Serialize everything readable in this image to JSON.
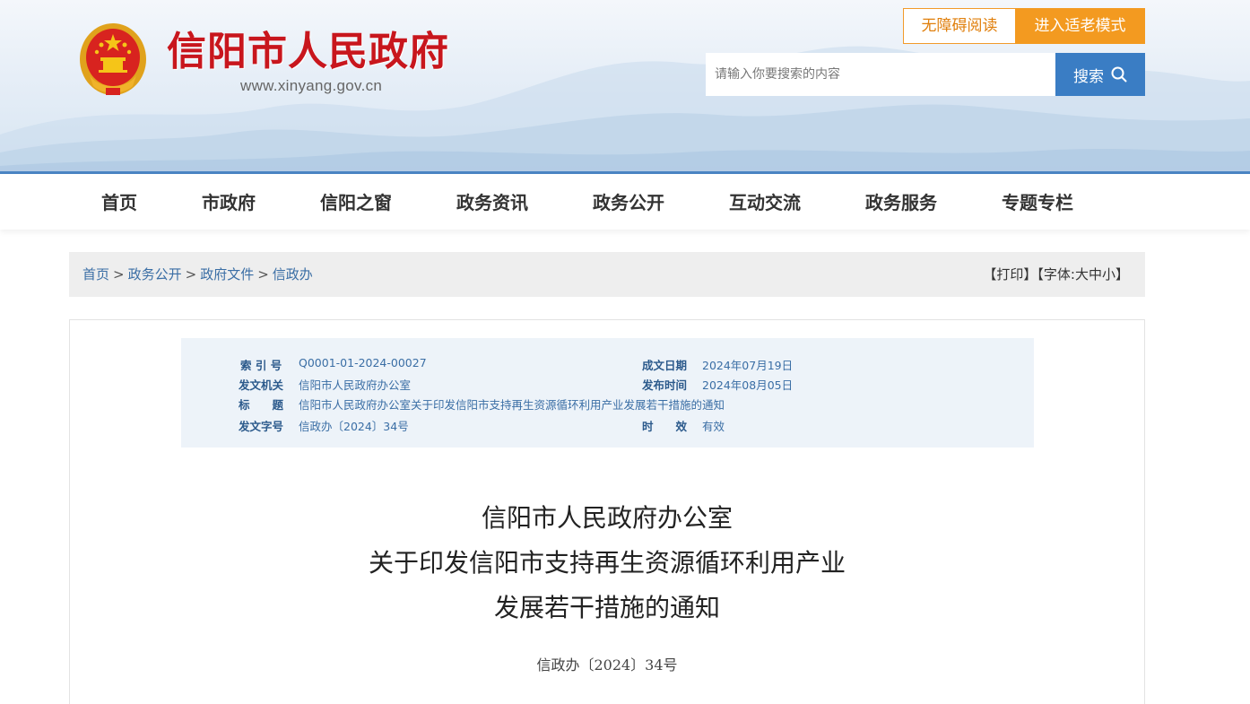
{
  "header": {
    "site_title": "信阳市人民政府",
    "site_url": "www.xinyang.gov.cn",
    "accessible_label": "无障碍阅读",
    "elder_mode_label": "进入适老模式",
    "search": {
      "placeholder": "请输入你要搜索的内容",
      "button_label": "搜索"
    }
  },
  "nav": {
    "items": [
      "首页",
      "市政府",
      "信阳之窗",
      "政务资讯",
      "政务公开",
      "互动交流",
      "政务服务",
      "专题专栏"
    ]
  },
  "breadcrumb": {
    "items": [
      "首页",
      "政务公开",
      "政府文件",
      "信政办"
    ],
    "separator": ">",
    "print_label": "【打印】",
    "font_label": "【字体:",
    "font_large": "大",
    "font_medium": "中",
    "font_small": "小",
    "font_close": "】"
  },
  "meta": {
    "index_key": "索 引 号",
    "index_value": "Q0001-01-2024-00027",
    "date_key": "成文日期",
    "date_value": "2024年07月19日",
    "issuer_key": "发文机关",
    "issuer_value": "信阳市人民政府办公室",
    "publish_key": "发布时间",
    "publish_value": "2024年08月05日",
    "title_key": "标　　题",
    "title_value": "信阳市人民政府办公室关于印发信阳市支持再生资源循环利用产业发展若干措施的通知",
    "docno_key": "发文字号",
    "docno_value": "信政办〔2024〕34号",
    "validity_key": "时　　效",
    "validity_value": "有效"
  },
  "document": {
    "title_line1": "信阳市人民政府办公室",
    "title_line2": "关于印发信阳市支持再生资源循环利用产业",
    "title_line3": "发展若干措施的通知",
    "doc_number": "信政办〔2024〕34号"
  },
  "colors": {
    "brand_red": "#c8161d",
    "accent_blue": "#3a7dc4",
    "accent_orange": "#f39a20",
    "link_blue": "#3a6ea5"
  },
  "icons": {
    "emblem": "national-emblem-icon",
    "search": "search-icon"
  }
}
